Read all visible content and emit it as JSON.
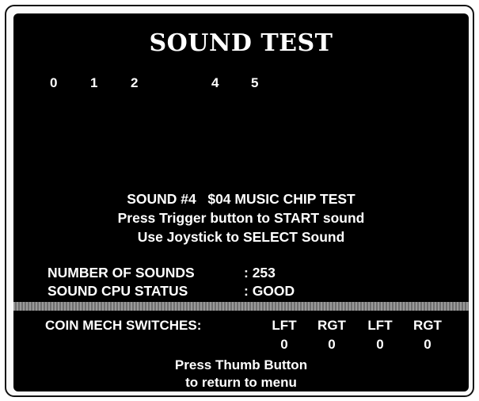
{
  "title": "SOUND TEST",
  "sound_digits": [
    "0",
    "1",
    "2",
    "4",
    "5"
  ],
  "info": {
    "line1": "SOUND #4   $04 MUSIC CHIP TEST",
    "line2": "Press Trigger button to START sound",
    "line3": "Use Joystick to SELECT Sound"
  },
  "stats": {
    "number_of_sounds_label": "NUMBER OF SOUNDS",
    "number_of_sounds_value": ": 253",
    "cpu_status_label": "SOUND CPU STATUS",
    "cpu_status_value": ": GOOD"
  },
  "coin_mech": {
    "label": "COIN MECH SWITCHES:",
    "columns": [
      "LFT",
      "RGT",
      "LFT",
      "RGT"
    ],
    "values": [
      "0",
      "0",
      "0",
      "0"
    ]
  },
  "footer": {
    "line1": "Press Thumb Button",
    "line2": "to return to menu"
  },
  "colors": {
    "screen_background": "#000000",
    "text": "#ffffff",
    "divider": "#8a8a8a"
  }
}
